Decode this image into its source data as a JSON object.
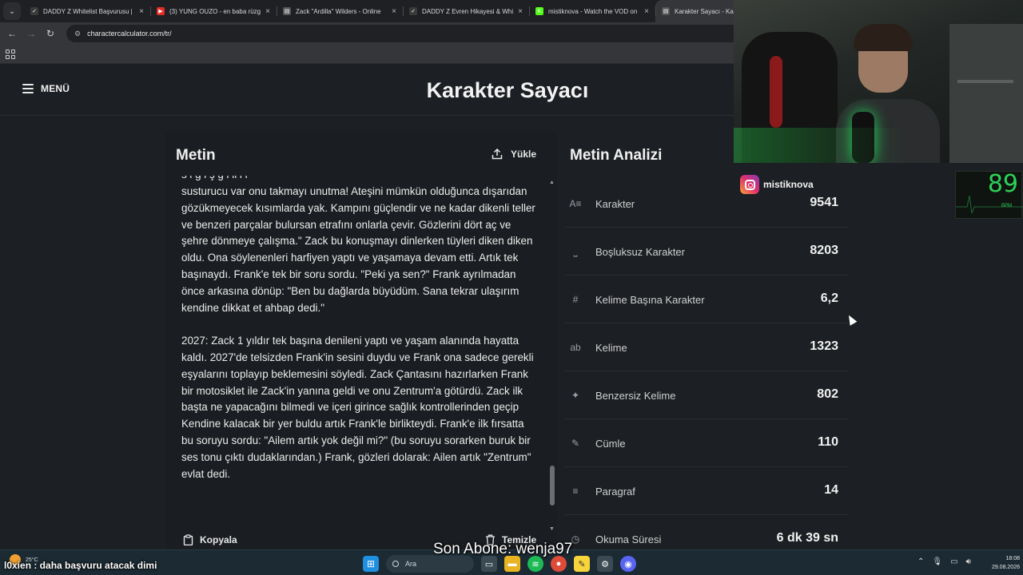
{
  "browser": {
    "tabs": [
      {
        "title": "DADDY Z Whitelist Başvurusu |",
        "fav_color": "#3a3a3a",
        "fav_glyph": "✓"
      },
      {
        "title": "(3) YUNG OUZO - en baba rüzg",
        "fav_color": "#e52d27",
        "fav_glyph": "▶"
      },
      {
        "title": "Zack \"Ardilla\" Wilders - Online",
        "fav_color": "#555555",
        "fav_glyph": "▤"
      },
      {
        "title": "DADDY Z Evren Hikayesi & Whi",
        "fav_color": "#3a3a3a",
        "fav_glyph": "✓"
      },
      {
        "title": "mistiknova - Watch the VOD on",
        "fav_color": "#53fc18",
        "fav_glyph": "K"
      },
      {
        "title": "Karakter Sayacı - Kara",
        "fav_color": "#555555",
        "fav_glyph": "▤"
      }
    ],
    "url": "charactercalculator.com/tr/"
  },
  "header": {
    "menu_label": "MENÜ",
    "title": "Karakter Sayacı"
  },
  "editor": {
    "title": "Metin",
    "upload_label": "Yükle",
    "partial_top_line": "s   i         ğ          i                          ş        ğ  i     il     i     l",
    "paragraphs": [
      "susturucu var onu takmayı unutma! Ateşini mümkün olduğunca dışarıdan gözükmeyecek kısımlarda yak. Kampını güçlendir ve ne kadar dikenli teller ve benzeri parçalar bulursan etrafını onlarla çevir. Gözlerini dört aç ve şehre dönmeye çalışma.\" Zack bu konuşmayı dinlerken tüyleri diken diken oldu. Ona söylenenleri harfiyen yaptı ve yaşamaya devam etti. Artık tek başınaydı. Frank'e tek bir soru sordu. \"Peki ya sen?\" Frank ayrılmadan önce arkasına dönüp: \"Ben bu dağlarda büyüdüm. Sana tekrar ulaşırım kendine dikkat et ahbap dedi.\"",
      "2027:  Zack 1 yıldır tek başına denileni yaptı ve yaşam alanında hayatta kaldı. 2027'de telsizden Frank'in sesini duydu ve Frank ona sadece gerekli eşyalarını toplayıp beklemesini söyledi. Zack Çantasını hazırlarken Frank bir motosiklet ile Zack'in yanına geldi ve onu Zentrum'a götürdü. Zack ilk başta ne yapacağını bilmedi ve içeri girince sağlık kontrollerinden geçip Kendine kalacak bir yer buldu artık Frank'le birlikteydi. Frank'e ilk fırsatta bu soruyu sordu: \"Ailem artık yok değil mi?\" (bu soruyu sorarken buruk bir ses tonu çıktı dudaklarından.) Frank, gözleri dolarak: Ailen artık \"Zentrum\" evlat dedi."
    ],
    "copy_label": "Kopyala",
    "clear_label": "Temizle"
  },
  "analysis": {
    "title": "Metin Analizi",
    "stats": [
      {
        "icon": "characters-icon",
        "glyph": "A≡",
        "label": "Karakter",
        "value": "9541"
      },
      {
        "icon": "no-space-icon",
        "glyph": "⎵",
        "label": "Boşluksuz Karakter",
        "value": "8203"
      },
      {
        "icon": "hash-icon",
        "glyph": "#",
        "label": "Kelime Başına Karakter",
        "value": "6,2"
      },
      {
        "icon": "words-icon",
        "glyph": "ab",
        "label": "Kelime",
        "value": "1323"
      },
      {
        "icon": "sparkle-icon",
        "glyph": "✦",
        "label": "Benzersiz Kelime",
        "value": "802"
      },
      {
        "icon": "pencil-icon",
        "glyph": "✎",
        "label": "Cümle",
        "value": "110"
      },
      {
        "icon": "paragraph-icon",
        "glyph": "≡",
        "label": "Paragraf",
        "value": "14"
      },
      {
        "icon": "clock-icon",
        "glyph": "◷",
        "label": "Okuma Süresi",
        "value": "6 dk 39 sn"
      }
    ]
  },
  "stream_overlay": {
    "instagram_handle": "mistiknova",
    "heart_rate": "89",
    "heart_rate_unit": "BPM",
    "subscriber_text": "Son Abone: wenja97",
    "chat_message": "l0xien : daha başvuru atacak dimi"
  },
  "taskbar": {
    "weather_temp": "25°C",
    "search_placeholder": "Ara",
    "time": "18:08",
    "date": "29.08.2026"
  }
}
